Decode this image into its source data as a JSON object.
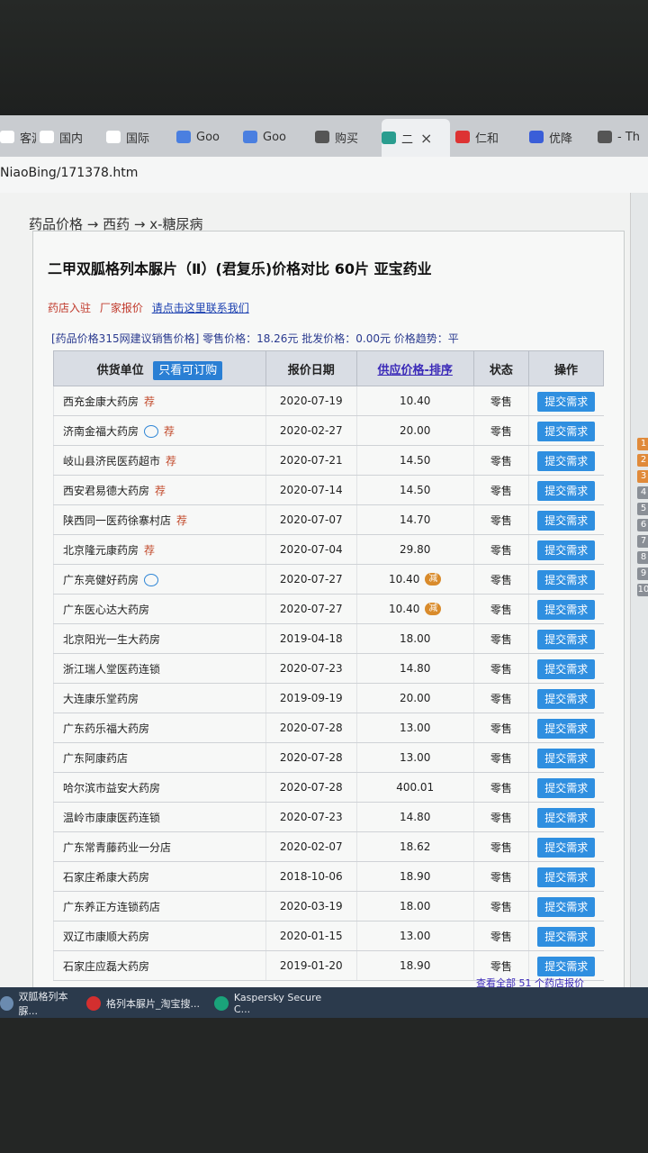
{
  "browser": {
    "tabs": [
      {
        "label": "客源",
        "color": "#ffffff"
      },
      {
        "label": "国内",
        "color": "#ffffff"
      },
      {
        "label": "国际",
        "color": "#ffffff"
      },
      {
        "label": "Goo",
        "color": "#4a7fe0"
      },
      {
        "label": "Goo",
        "color": "#4a7fe0"
      },
      {
        "label": "购买",
        "color": "#555555"
      },
      {
        "label": "二",
        "color": "#2a9d8f"
      },
      {
        "label": "仁和",
        "color": "#d33"
      },
      {
        "label": "优降",
        "color": "#3a5ed8"
      },
      {
        "label": "- Th",
        "color": "#555555"
      }
    ],
    "active_tab_close": "×",
    "url": "NiaoBing/171378.htm"
  },
  "page": {
    "breadcrumb": "药品价格 → 西药 → x-糖尿病",
    "title": "二甲双胍格列本脲片（Ⅱ）(君复乐)价格对比 60片 亚宝药业",
    "links": {
      "a": "药店入驻",
      "b": "厂家报价",
      "c": "请点击这里联系我们"
    },
    "priceline": "[药品价格315网建议销售价格] 零售价格：18.26元 批发价格：0.00元 价格趋势：平",
    "table": {
      "headers": {
        "supplier": "供货单位",
        "only": "只看可订购",
        "date": "报价日期",
        "price": "供应价格-排序",
        "status": "状态",
        "op": "操作"
      },
      "rows": [
        {
          "name": "西充金康大药房",
          "rec": "荐",
          "chat": false,
          "date": "2020-07-19",
          "price": "10.40",
          "cut": false,
          "status": "零售",
          "btn": "提交需求"
        },
        {
          "name": "济南金福大药房",
          "rec": "荐",
          "chat": true,
          "date": "2020-02-27",
          "price": "20.00",
          "cut": false,
          "status": "零售",
          "btn": "提交需求"
        },
        {
          "name": "岐山县济民医药超市",
          "rec": "荐",
          "chat": false,
          "date": "2020-07-21",
          "price": "14.50",
          "cut": false,
          "status": "零售",
          "btn": "提交需求"
        },
        {
          "name": "西安君易德大药房",
          "rec": "荐",
          "chat": false,
          "date": "2020-07-14",
          "price": "14.50",
          "cut": false,
          "status": "零售",
          "btn": "提交需求"
        },
        {
          "name": "陕西同一医药徐寨村店",
          "rec": "荐",
          "chat": false,
          "date": "2020-07-07",
          "price": "14.70",
          "cut": false,
          "status": "零售",
          "btn": "提交需求"
        },
        {
          "name": "北京隆元康药房",
          "rec": "荐",
          "chat": false,
          "date": "2020-07-04",
          "price": "29.80",
          "cut": false,
          "status": "零售",
          "btn": "提交需求"
        },
        {
          "name": "广东亮健好药房",
          "rec": "",
          "chat": true,
          "date": "2020-07-27",
          "price": "10.40",
          "cut": true,
          "status": "零售",
          "btn": "提交需求"
        },
        {
          "name": "广东医心达大药房",
          "rec": "",
          "chat": false,
          "date": "2020-07-27",
          "price": "10.40",
          "cut": true,
          "status": "零售",
          "btn": "提交需求"
        },
        {
          "name": "北京阳光一生大药房",
          "rec": "",
          "chat": false,
          "date": "2019-04-18",
          "price": "18.00",
          "cut": false,
          "status": "零售",
          "btn": "提交需求"
        },
        {
          "name": "浙江瑞人堂医药连锁",
          "rec": "",
          "chat": false,
          "date": "2020-07-23",
          "price": "14.80",
          "cut": false,
          "status": "零售",
          "btn": "提交需求"
        },
        {
          "name": "大连康乐堂药房",
          "rec": "",
          "chat": false,
          "date": "2019-09-19",
          "price": "20.00",
          "cut": false,
          "status": "零售",
          "btn": "提交需求"
        },
        {
          "name": "广东药乐福大药房",
          "rec": "",
          "chat": false,
          "date": "2020-07-28",
          "price": "13.00",
          "cut": false,
          "status": "零售",
          "btn": "提交需求"
        },
        {
          "name": "广东阿康药店",
          "rec": "",
          "chat": false,
          "date": "2020-07-28",
          "price": "13.00",
          "cut": false,
          "status": "零售",
          "btn": "提交需求"
        },
        {
          "name": "哈尔滨市益安大药房",
          "rec": "",
          "chat": false,
          "date": "2020-07-28",
          "price": "400.01",
          "cut": false,
          "status": "零售",
          "btn": "提交需求"
        },
        {
          "name": "温岭市康康医药连锁",
          "rec": "",
          "chat": false,
          "date": "2020-07-23",
          "price": "14.80",
          "cut": false,
          "status": "零售",
          "btn": "提交需求"
        },
        {
          "name": "广东常青藤药业一分店",
          "rec": "",
          "chat": false,
          "date": "2020-02-07",
          "price": "18.62",
          "cut": false,
          "status": "零售",
          "btn": "提交需求"
        },
        {
          "name": "石家庄希康大药房",
          "rec": "",
          "chat": false,
          "date": "2018-10-06",
          "price": "18.90",
          "cut": false,
          "status": "零售",
          "btn": "提交需求"
        },
        {
          "name": "广东养正方连锁药店",
          "rec": "",
          "chat": false,
          "date": "2020-03-19",
          "price": "18.00",
          "cut": false,
          "status": "零售",
          "btn": "提交需求"
        },
        {
          "name": "双辽市康顺大药房",
          "rec": "",
          "chat": false,
          "date": "2020-01-15",
          "price": "13.00",
          "cut": false,
          "status": "零售",
          "btn": "提交需求"
        },
        {
          "name": "石家庄应磊大药房",
          "rec": "",
          "chat": false,
          "date": "2019-01-20",
          "price": "18.90",
          "cut": false,
          "status": "零售",
          "btn": "提交需求"
        }
      ],
      "cut_label": "减",
      "more": "查看全部 51 个药店报价"
    },
    "sidebar_numbers": [
      "1",
      "2",
      "3",
      "4",
      "5",
      "6",
      "7",
      "8",
      "9",
      "10"
    ]
  },
  "taskbar": [
    {
      "label": "双胍格列本脲...",
      "color": "#6b8bb0"
    },
    {
      "label": "格列本脲片_淘宝搜...",
      "color": "#d32f2f"
    },
    {
      "label": "Kaspersky Secure C...",
      "color": "#1aa37a"
    }
  ]
}
